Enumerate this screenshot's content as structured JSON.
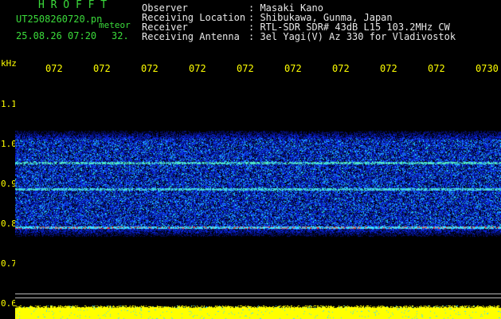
{
  "header": {
    "logo": "H R O F F T",
    "filename": "UT2508260720.pn",
    "mode": "meteor",
    "datetime": "25.08.26 07:20",
    "count": "32.",
    "rows": [
      {
        "label": "Observer",
        "value": ": Masaki Kano"
      },
      {
        "label": "Receiving Location",
        "value": ": Shibukawa, Gunma, Japan"
      },
      {
        "label": "Receiver",
        "value": ": RTL-SDR SDR# 43dB L15 103.2MHz CW"
      },
      {
        "label": "Receiving Antenna",
        "value": ": 3el Yagi(V) Az 330 for Vladivostok"
      }
    ]
  },
  "spectrogram": {
    "y_unit": "kHz",
    "time_ticks": [
      "072",
      "072",
      "072",
      "072",
      "072",
      "072",
      "072",
      "072",
      "072",
      "0730"
    ],
    "freq_ticks": [
      "1.1",
      "1.0",
      "0.9",
      "0.8",
      "0.7",
      "0.6"
    ],
    "colors": {
      "background": "#000000",
      "text_green": "#3bdc3b",
      "axis_yellow": "#ffff00",
      "noise_blue": "#1030ff",
      "signal_cyan": "#40e0ff",
      "signal_red": "#ff3030"
    }
  }
}
